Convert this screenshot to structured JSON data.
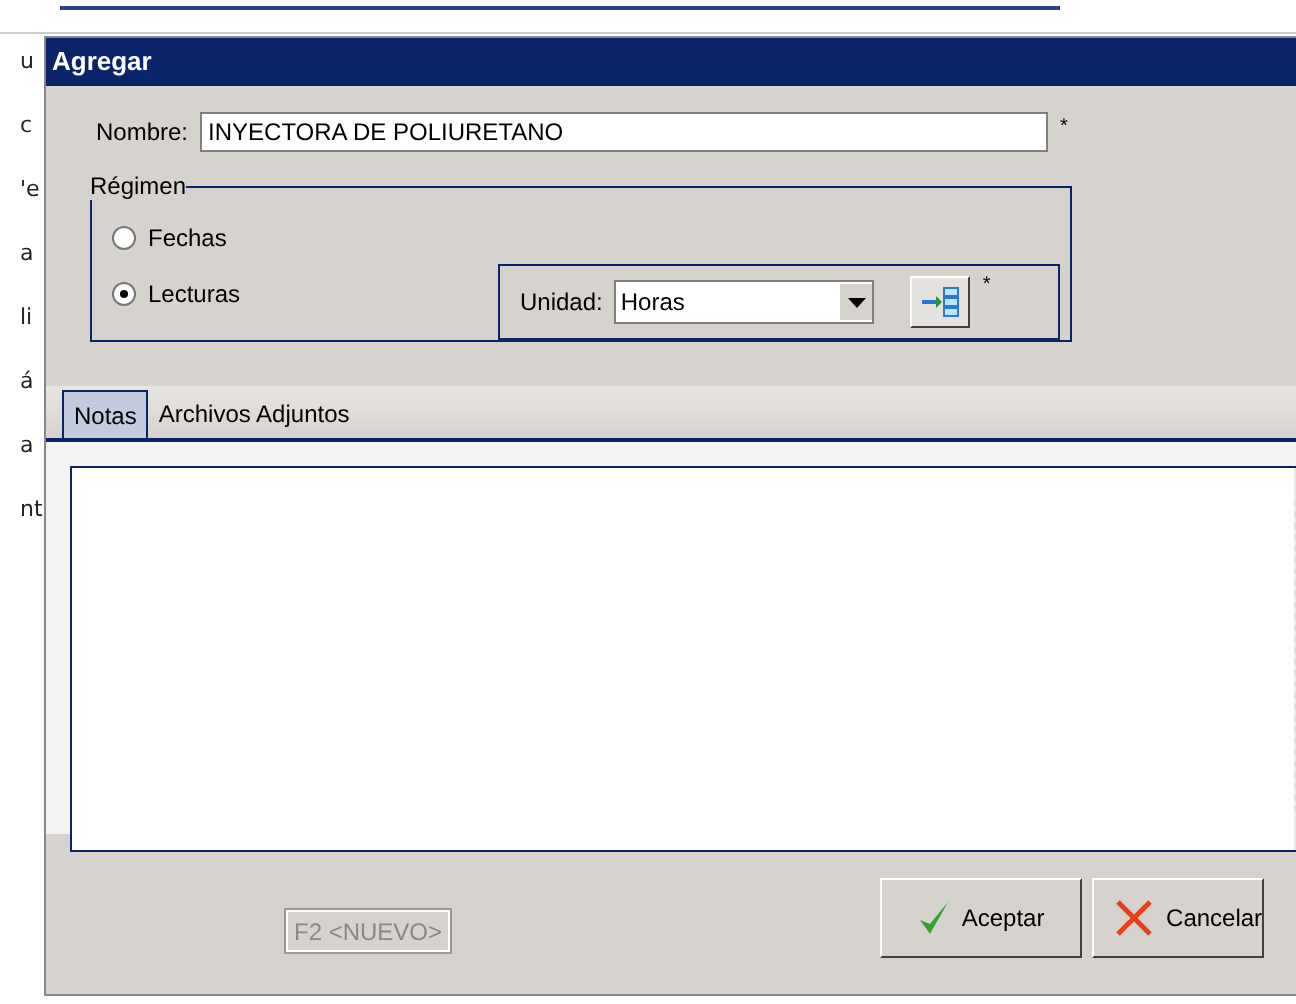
{
  "background": {
    "left_fragments": [
      "u",
      "c",
      "'e",
      "a",
      "li",
      "á",
      "a",
      "nt"
    ]
  },
  "window": {
    "title": "Agregar"
  },
  "nombre": {
    "label": "Nombre:",
    "value": "INYECTORA DE POLIURETANO",
    "required_mark": "*"
  },
  "regimen": {
    "title": "Régimen",
    "options": [
      {
        "label": "Fechas",
        "selected": false
      },
      {
        "label": "Lecturas",
        "selected": true
      }
    ],
    "unidad": {
      "label": "Unidad:",
      "value": "Horas",
      "required_mark": "*"
    }
  },
  "tabs": [
    {
      "label": "Notas",
      "selected": true
    },
    {
      "label": "Archivos Adjuntos",
      "selected": false
    }
  ],
  "buttons": [
    {
      "kind": "new",
      "label": "F2 <NUEVO>",
      "disabled": true
    },
    {
      "kind": "accept",
      "label": "Aceptar",
      "disabled": false
    },
    {
      "kind": "cancel",
      "label": "Cancelar",
      "disabled": false
    }
  ]
}
